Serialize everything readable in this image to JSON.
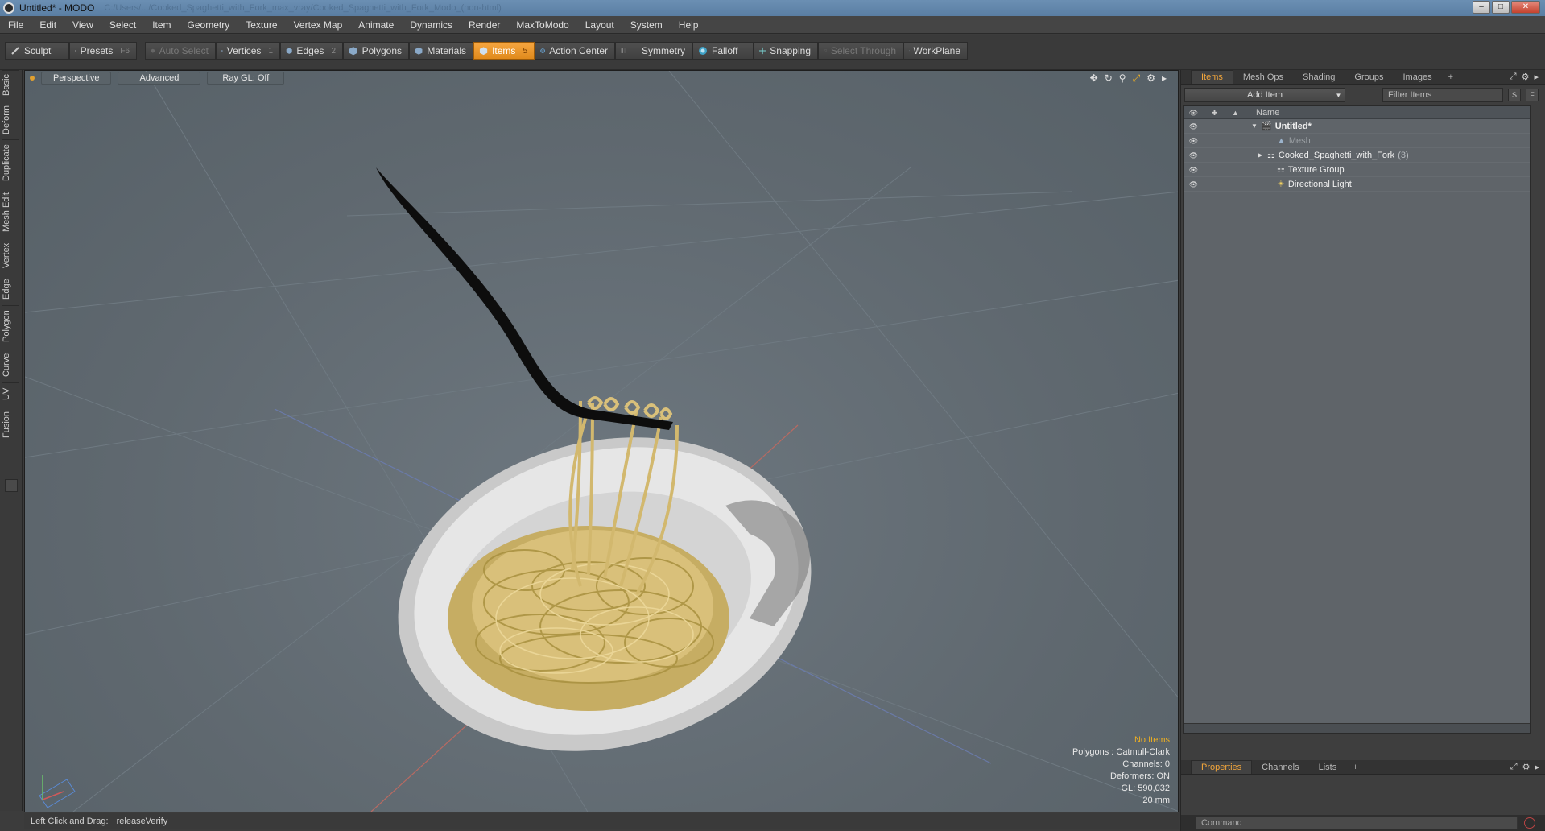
{
  "window": {
    "title": "Untitled* - MODO",
    "path": "C:/Users/.../Cooked_Spaghetti_with_Fork_max_vray/Cooked_Spaghetti_with_Fork_Modo_(non-html)"
  },
  "menu": [
    "File",
    "Edit",
    "View",
    "Select",
    "Item",
    "Geometry",
    "Texture",
    "Vertex Map",
    "Animate",
    "Dynamics",
    "Render",
    "MaxToModo",
    "Layout",
    "System",
    "Help"
  ],
  "toolbar": {
    "sculpt": "Sculpt",
    "presets": "Presets",
    "presets_key": "F6",
    "auto_select": "Auto Select",
    "vertices": "Vertices",
    "vertices_key": "1",
    "edges": "Edges",
    "edges_key": "2",
    "polygons": "Polygons",
    "materials": "Materials",
    "items": "Items",
    "items_key": "5",
    "action_center": "Action Center",
    "symmetry": "Symmetry",
    "falloff": "Falloff",
    "snapping": "Snapping",
    "select_through": "Select Through",
    "workplane": "WorkPlane"
  },
  "left_tabs": [
    "Basic",
    "Deform",
    "Duplicate",
    "Mesh Edit",
    "Vertex",
    "Edge",
    "Polygon",
    "Curve",
    "UV",
    "Fusion"
  ],
  "viewport": {
    "view": "Perspective",
    "mode": "Advanced",
    "raygl": "Ray GL: Off",
    "stats": {
      "selection": "No Items",
      "polygons": "Polygons : Catmull-Clark",
      "channels": "Channels: 0",
      "deformers": "Deformers: ON",
      "gl": "GL: 590,032",
      "scale": "20 mm"
    }
  },
  "status": {
    "hint": "Left Click and Drag:",
    "action": "releaseVerify"
  },
  "panel": {
    "tabs": [
      "Items",
      "Mesh Ops",
      "Shading",
      "Groups",
      "Images"
    ],
    "add_item": "Add Item",
    "filter_placeholder": "Filter Items",
    "s": "S",
    "f": "F",
    "name_header": "Name",
    "tree": [
      {
        "label": "Untitled*",
        "indent": 0,
        "bold": true
      },
      {
        "label": "Mesh",
        "indent": 1,
        "dim": true
      },
      {
        "label": "Cooked_Spaghetti_with_Fork",
        "count": "(3)",
        "indent": 1
      },
      {
        "label": "Texture Group",
        "indent": 1
      },
      {
        "label": "Directional Light",
        "indent": 1
      }
    ],
    "bottom_tabs": [
      "Properties",
      "Channels",
      "Lists"
    ],
    "command_placeholder": "Command"
  },
  "colors": {
    "accent": "#f3a63b",
    "viewport_bg": "#5f686f",
    "noodle": "#d9c07a"
  }
}
